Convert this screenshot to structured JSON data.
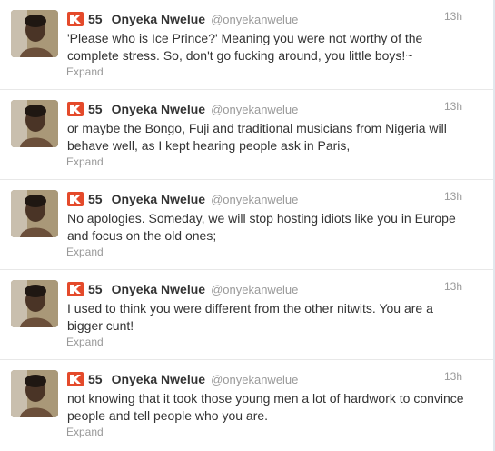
{
  "colors": {
    "klout_orange": "#E44A2B",
    "name": "#333333",
    "meta": "#999999"
  },
  "tweets": [
    {
      "klout_score": "55",
      "fullname": "Onyeka Nwelue",
      "username": "@onyekanwelue",
      "time": "13h",
      "text": "'Please who is Ice Prince?' Meaning you were not worthy of the complete stress. So, don't go fucking around, you little boys!~",
      "expand": "Expand"
    },
    {
      "klout_score": "55",
      "fullname": "Onyeka Nwelue",
      "username": "@onyekanwelue",
      "time": "13h",
      "text": "or maybe the Bongo, Fuji and traditional musicians from Nigeria will behave well, as I kept hearing people ask in Paris,",
      "expand": "Expand"
    },
    {
      "klout_score": "55",
      "fullname": "Onyeka Nwelue",
      "username": "@onyekanwelue",
      "time": "13h",
      "text": "No apologies. Someday, we will stop hosting idiots like you in Europe and focus on the old ones;",
      "expand": "Expand"
    },
    {
      "klout_score": "55",
      "fullname": "Onyeka Nwelue",
      "username": "@onyekanwelue",
      "time": "13h",
      "text": "I used to think you were different from the other nitwits. You are a bigger cunt!",
      "expand": "Expand"
    },
    {
      "klout_score": "55",
      "fullname": "Onyeka Nwelue",
      "username": "@onyekanwelue",
      "time": "13h",
      "text": "not knowing that it took those young men a lot of hardwork to convince people and tell people who you are.",
      "expand": "Expand"
    }
  ]
}
